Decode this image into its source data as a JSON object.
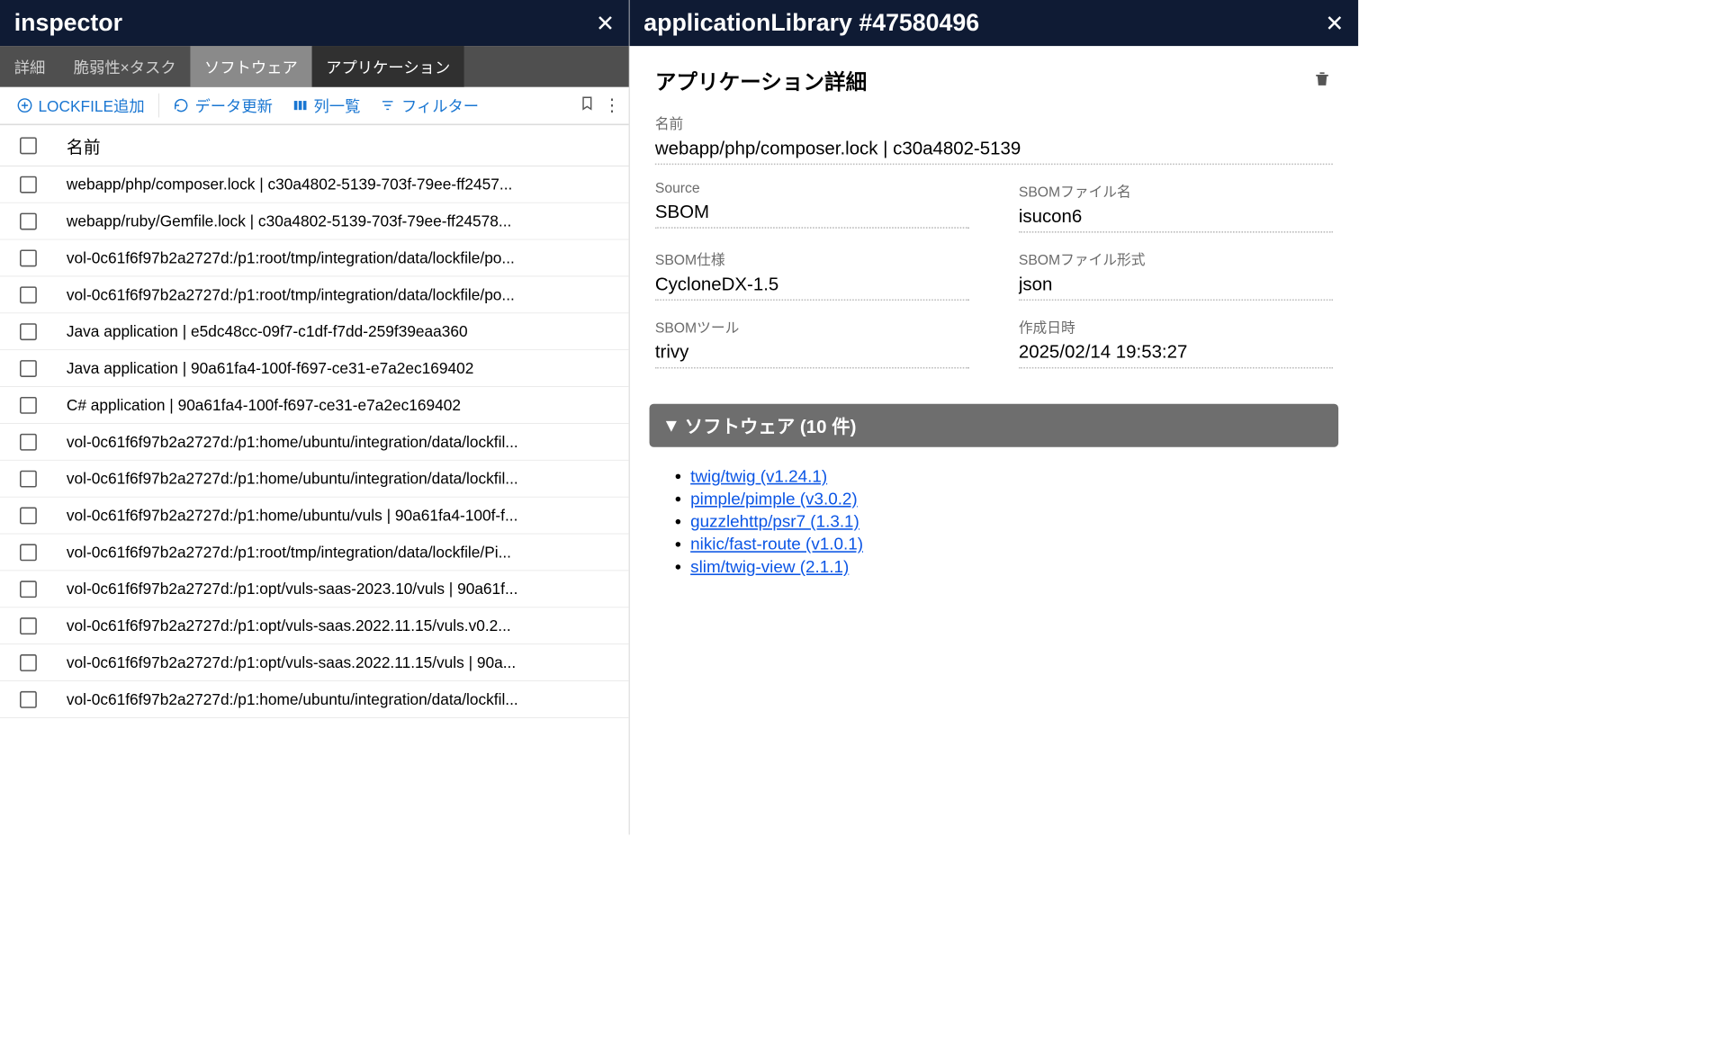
{
  "left": {
    "title": "inspector",
    "tabs": [
      "詳細",
      "脆弱性×タスク",
      "ソフトウェア",
      "アプリケーション"
    ],
    "active_tab_index": 3,
    "toolbar": {
      "lockfile": "LOCKFILE追加",
      "refresh": "データ更新",
      "columns": "列一覧",
      "filter": "フィルター"
    },
    "name_header": "名前",
    "rows": [
      "webapp/php/composer.lock | c30a4802-5139-703f-79ee-ff2457...",
      "webapp/ruby/Gemfile.lock | c30a4802-5139-703f-79ee-ff24578...",
      "vol-0c61f6f97b2a2727d:/p1:root/tmp/integration/data/lockfile/po...",
      "vol-0c61f6f97b2a2727d:/p1:root/tmp/integration/data/lockfile/po...",
      "Java application | e5dc48cc-09f7-c1df-f7dd-259f39eaa360",
      "Java application | 90a61fa4-100f-f697-ce31-e7a2ec169402",
      "C# application | 90a61fa4-100f-f697-ce31-e7a2ec169402",
      "vol-0c61f6f97b2a2727d:/p1:home/ubuntu/integration/data/lockfil...",
      "vol-0c61f6f97b2a2727d:/p1:home/ubuntu/integration/data/lockfil...",
      "vol-0c61f6f97b2a2727d:/p1:home/ubuntu/vuls | 90a61fa4-100f-f...",
      "vol-0c61f6f97b2a2727d:/p1:root/tmp/integration/data/lockfile/Pi...",
      "vol-0c61f6f97b2a2727d:/p1:opt/vuls-saas-2023.10/vuls | 90a61f...",
      "vol-0c61f6f97b2a2727d:/p1:opt/vuls-saas.2022.11.15/vuls.v0.2...",
      "vol-0c61f6f97b2a2727d:/p1:opt/vuls-saas.2022.11.15/vuls | 90a...",
      "vol-0c61f6f97b2a2727d:/p1:home/ubuntu/integration/data/lockfil..."
    ]
  },
  "right": {
    "title": "applicationLibrary #47580496",
    "section_title": "アプリケーション詳細",
    "fields": {
      "name_label": "名前",
      "name_value": "webapp/php/composer.lock | c30a4802-5139",
      "source_label": "Source",
      "source_value": "SBOM",
      "sbom_file_label": "SBOMファイル名",
      "sbom_file_value": "isucon6",
      "sbom_spec_label": "SBOM仕様",
      "sbom_spec_value": "CycloneDX-1.5",
      "sbom_fmt_label": "SBOMファイル形式",
      "sbom_fmt_value": "json",
      "sbom_tool_label": "SBOMツール",
      "sbom_tool_value": "trivy",
      "created_label": "作成日時",
      "created_value": "2025/02/14 19:53:27"
    },
    "software_header": "ソフトウェア (10 件)",
    "software": [
      "twig/twig (v1.24.1)",
      "pimple/pimple (v3.0.2)",
      "guzzlehttp/psr7 (1.3.1)",
      "nikic/fast-route (v1.0.1)",
      "slim/twig-view (2.1.1)"
    ]
  }
}
